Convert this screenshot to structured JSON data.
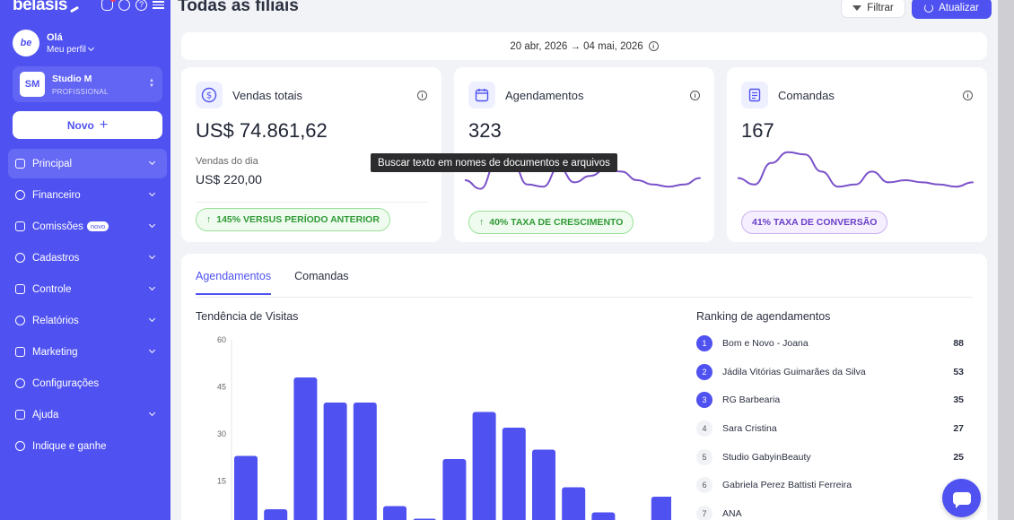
{
  "brand": {
    "name": "belasis"
  },
  "profile": {
    "avatar": "be",
    "greeting": "Olá",
    "link": "Meu perfil"
  },
  "studio": {
    "initials": "SM",
    "name": "Studio M",
    "plan": "PROFISSIONAL"
  },
  "new_button": {
    "label": "Novo",
    "icon": "plus-icon"
  },
  "nav": [
    {
      "label": "Principal",
      "icon": "home-icon",
      "active": true,
      "chevron": true
    },
    {
      "label": "Financeiro",
      "icon": "dollar-icon",
      "chevron": true
    },
    {
      "label": "Comissões",
      "icon": "pie-icon",
      "badge": "novo",
      "chevron": true
    },
    {
      "label": "Cadastros",
      "icon": "users-icon",
      "chevron": true
    },
    {
      "label": "Controle",
      "icon": "grid-icon",
      "chevron": true
    },
    {
      "label": "Relatórios",
      "icon": "chart-icon",
      "chevron": true
    },
    {
      "label": "Marketing",
      "icon": "megaphone-icon",
      "chevron": true
    },
    {
      "label": "Configurações",
      "icon": "gear-icon",
      "chevron": false
    },
    {
      "label": "Ajuda",
      "icon": "help-icon",
      "chevron": true
    },
    {
      "label": "Indique e ganhe",
      "icon": "gift-icon",
      "chevron": false
    }
  ],
  "header": {
    "title": "Todas as filiais",
    "filter_label": "Filtrar",
    "refresh_label": "Atualizar"
  },
  "date_range": "20 abr, 2026 → 04 mai, 2026",
  "cards": {
    "sales": {
      "title": "Vendas totais",
      "value": "US$ 74.861,62",
      "sub_label": "Vendas do dia",
      "sub_value": "US$ 220,00",
      "pill": "145% VERSUS PERÍODO ANTERIOR"
    },
    "appointments": {
      "title": "Agendamentos",
      "value": "323",
      "pill": "40% TAXA DE CRESCIMENTO"
    },
    "orders": {
      "title": "Comandas",
      "value": "167",
      "pill": "41% TAXA DE CONVERSÃO"
    }
  },
  "tooltip": "Buscar texto em nomes de documentos e arquivos",
  "tabs": [
    "Agendamentos",
    "Comandas"
  ],
  "chart_title": "Tendência de Visitas",
  "ranking_title": "Ranking de agendamentos",
  "ranking": [
    {
      "pos": "1",
      "name": "Bom e Novo - Joana",
      "value": "88"
    },
    {
      "pos": "2",
      "name": "Jádila Vitórias Guimarães da Silva",
      "value": "53"
    },
    {
      "pos": "3",
      "name": "RG Barbearia",
      "value": "35"
    },
    {
      "pos": "4",
      "name": "Sara Cristina",
      "value": "27"
    },
    {
      "pos": "5",
      "name": "Studio GabyinBeauty",
      "value": "25"
    },
    {
      "pos": "6",
      "name": "Gabriela Perez Battisti Ferreira",
      "value": ""
    },
    {
      "pos": "7",
      "name": "ANA",
      "value": ""
    }
  ],
  "chart_data": {
    "type": "bar",
    "title": "Tendência de Visitas",
    "yticks": [
      "60",
      "45",
      "30",
      "15"
    ],
    "ylim": [
      0,
      60
    ],
    "values": [
      23,
      6,
      48,
      40,
      40,
      7,
      3,
      22,
      37,
      32,
      25,
      13,
      5,
      0,
      10
    ],
    "color": "#4f52f0"
  },
  "sparklines": {
    "appointments": [
      0.75,
      0.95,
      0.35,
      0.3,
      0.85,
      0.9,
      0.45,
      0.8,
      0.65,
      0.5,
      0.55,
      0.75,
      0.85,
      0.9,
      0.85,
      0.7
    ],
    "orders": [
      0.7,
      0.85,
      0.35,
      0.1,
      0.15,
      0.55,
      0.9,
      0.85,
      0.55,
      0.8,
      0.75,
      0.8,
      0.85,
      0.9,
      0.8
    ]
  },
  "colors": {
    "accent": "#4f52f0",
    "green": "#2f9a35",
    "purple": "#6a3fc7",
    "sparkline": "#7b52c9"
  }
}
